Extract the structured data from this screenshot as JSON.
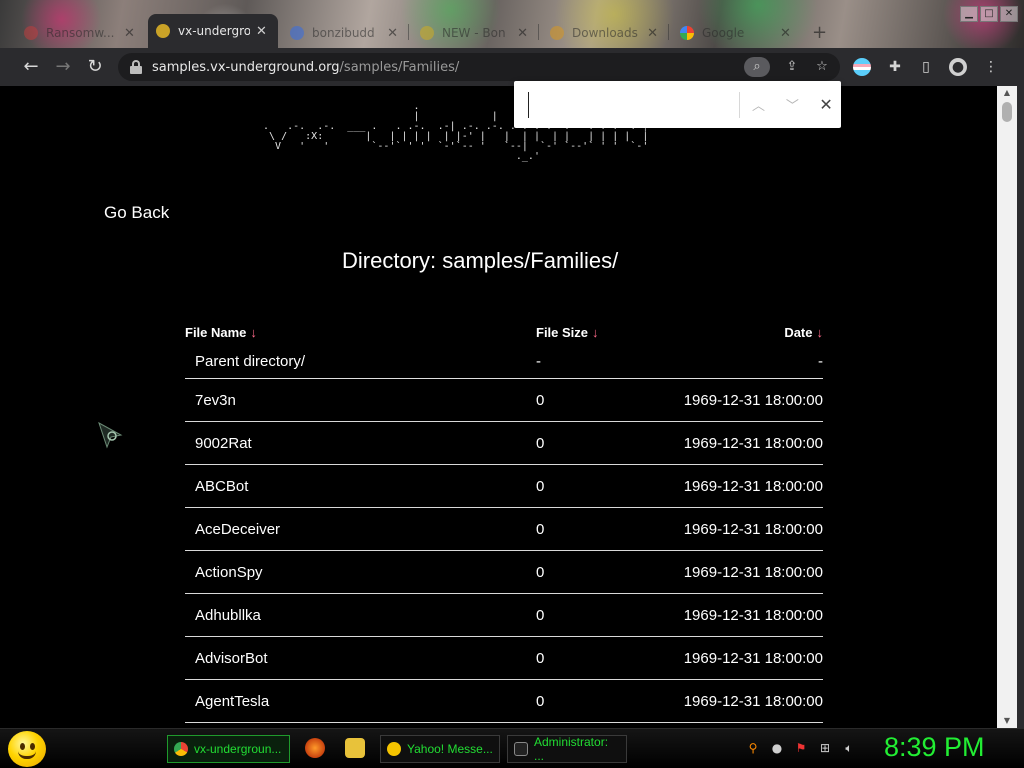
{
  "browser": {
    "tabs": [
      {
        "label": "Ransomw..."
      },
      {
        "label": "vx-undergro"
      },
      {
        "label": "bonzibudd"
      },
      {
        "label": "NEW - Bon"
      },
      {
        "label": "Downloads"
      },
      {
        "label": "Google"
      }
    ],
    "url_host": "samples.vx-underground.org",
    "url_path": "/samples/Families/"
  },
  "find_bar": {
    "value": ""
  },
  "page": {
    "logo_lines": [
      "                          .             ",
      "                          |            |",
      " .   .-.  .-.  ___ .   . .-.  .-| .-. .-. .-. .-.  .   . .-.  .-|",
      "  \\ /   :X:       |   | | | |  | |-' |   |  | |  | |   | | | |  |",
      "   V   '   '       `--'` ' '  `-'`-- '   `--|  `-' `--'` ' '  `-'",
      "                                           ._.'                   "
    ],
    "go_back": "Go Back",
    "directory_title": "Directory: samples/Families/"
  },
  "table": {
    "headers": {
      "name": "File Name",
      "size": "File Size",
      "date": "Date",
      "arrow": "↓"
    },
    "parent": {
      "name": "Parent directory/",
      "size": "-",
      "date": "-"
    },
    "rows": [
      {
        "name": "7ev3n",
        "size": "0",
        "date": "1969-12-31 18:00:00"
      },
      {
        "name": "9002Rat",
        "size": "0",
        "date": "1969-12-31 18:00:00"
      },
      {
        "name": "ABCBot",
        "size": "0",
        "date": "1969-12-31 18:00:00"
      },
      {
        "name": "AceDeceiver",
        "size": "0",
        "date": "1969-12-31 18:00:00"
      },
      {
        "name": "ActionSpy",
        "size": "0",
        "date": "1969-12-31 18:00:00"
      },
      {
        "name": "Adhubllka",
        "size": "0",
        "date": "1969-12-31 18:00:00"
      },
      {
        "name": "AdvisorBot",
        "size": "0",
        "date": "1969-12-31 18:00:00"
      },
      {
        "name": "AgentTesla",
        "size": "0",
        "date": "1969-12-31 18:00:00"
      }
    ]
  },
  "taskbar": {
    "tasks": [
      {
        "label": "vx-undergroun..."
      },
      {
        "label": "Yahoo! Messe..."
      },
      {
        "label": "Administrator: ..."
      }
    ],
    "clock": "8:39 PM"
  },
  "colors": {
    "accent_arrow": "#ff6a8a",
    "taskbar_text": "#22dd33",
    "page_bg": "#000000"
  }
}
